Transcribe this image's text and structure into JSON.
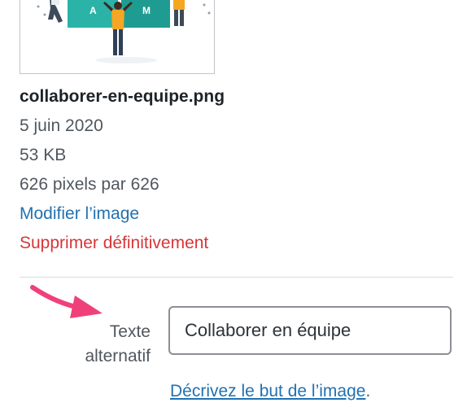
{
  "attachment": {
    "filename": "collaborer-en-equipe.png",
    "date": "5 juin 2020",
    "size": "53 KB",
    "dimensions": "626 pixels par 626",
    "edit_link": "Modifier l’image",
    "delete_link": "Supprimer définitivement",
    "thumbnail_letters": [
      "A",
      "M"
    ]
  },
  "alt_text": {
    "label_line1": "Texte",
    "label_line2": "alternatif",
    "value": "Collaborer en équipe",
    "help_link": "Décrivez le but de l’image",
    "help_suffix": "."
  },
  "colors": {
    "link": "#2271b1",
    "delete": "#d63638",
    "annotation_arrow": "#f0407a",
    "thumb_teal": "#2bb3a7",
    "thumb_orange": "#f5a623"
  },
  "icons": {
    "annotation": "arrow-pointer-icon"
  }
}
